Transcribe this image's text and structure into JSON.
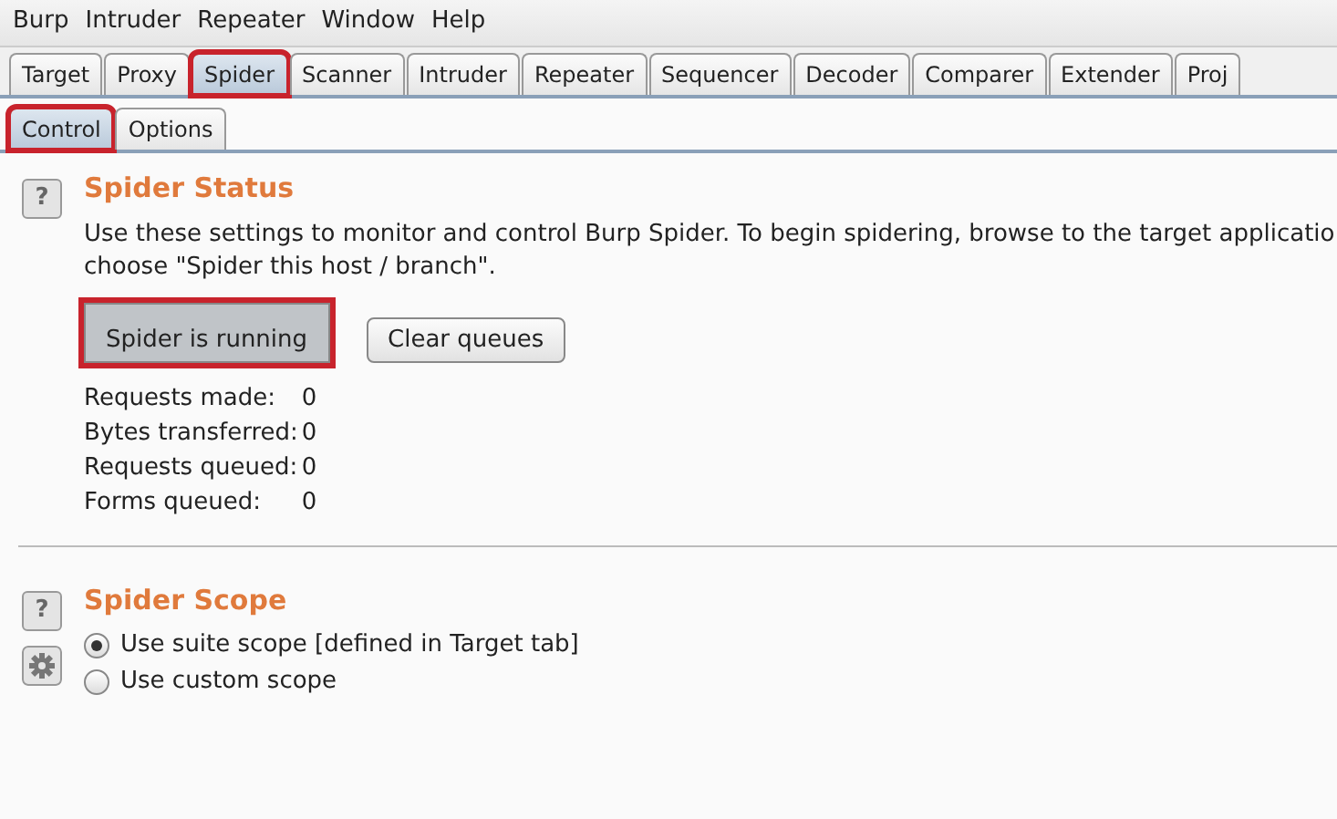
{
  "menu": [
    "Burp",
    "Intruder",
    "Repeater",
    "Window",
    "Help"
  ],
  "tabs": [
    {
      "label": "Target",
      "selected": false,
      "highlighted": false
    },
    {
      "label": "Proxy",
      "selected": false,
      "highlighted": false
    },
    {
      "label": "Spider",
      "selected": true,
      "highlighted": true
    },
    {
      "label": "Scanner",
      "selected": false,
      "highlighted": false
    },
    {
      "label": "Intruder",
      "selected": false,
      "highlighted": false
    },
    {
      "label": "Repeater",
      "selected": false,
      "highlighted": false
    },
    {
      "label": "Sequencer",
      "selected": false,
      "highlighted": false
    },
    {
      "label": "Decoder",
      "selected": false,
      "highlighted": false
    },
    {
      "label": "Comparer",
      "selected": false,
      "highlighted": false
    },
    {
      "label": "Extender",
      "selected": false,
      "highlighted": false
    },
    {
      "label": "Proj",
      "selected": false,
      "highlighted": false
    }
  ],
  "subtabs": [
    {
      "label": "Control",
      "selected": true,
      "highlighted": true
    },
    {
      "label": "Options",
      "selected": false,
      "highlighted": false
    }
  ],
  "status": {
    "help": "?",
    "title": "Spider Status",
    "description": [
      "Use these settings to monitor and control Burp Spider. To begin spidering, browse to the target applicatio",
      "choose \"Spider this host / branch\"."
    ],
    "buttons": [
      {
        "label": "Spider is running",
        "pressed": true,
        "highlighted": true
      },
      {
        "label": "Clear queues",
        "pressed": false,
        "highlighted": false
      }
    ],
    "stats": [
      {
        "label": "Requests made:",
        "value": "0"
      },
      {
        "label": "Bytes transferred:",
        "value": "0"
      },
      {
        "label": "Requests queued:",
        "value": "0"
      },
      {
        "label": "Forms queued:",
        "value": "0"
      }
    ]
  },
  "scope": {
    "help": "?",
    "title": "Spider Scope",
    "options": [
      {
        "label": "Use suite scope [defined in Target tab]",
        "selected": true
      },
      {
        "label": "Use custom scope",
        "selected": false
      }
    ]
  }
}
